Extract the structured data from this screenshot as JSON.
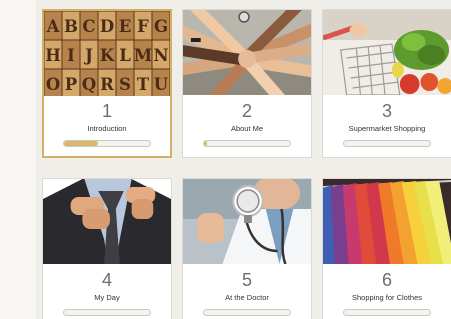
{
  "lessons": [
    {
      "number": "1",
      "title": "Introduction",
      "progress": 0.4,
      "image": "wooden-letter-blocks",
      "active": true
    },
    {
      "number": "2",
      "title": "About Me",
      "progress": 0.04,
      "image": "team-hands-stack",
      "active": false
    },
    {
      "number": "3",
      "title": "Supermarket Shopping",
      "progress": 0,
      "image": "shopping-cart-vegetables",
      "active": false
    },
    {
      "number": "4",
      "title": "My Day",
      "progress": 0,
      "image": "man-adjusting-tie",
      "active": false
    },
    {
      "number": "5",
      "title": "At the Doctor",
      "progress": 0,
      "image": "doctor-stethoscope",
      "active": false
    },
    {
      "number": "6",
      "title": "Shopping for Clothes",
      "progress": 0,
      "image": "clothes-rack",
      "active": false
    }
  ],
  "letter_blocks": [
    "A",
    "B",
    "C",
    "D",
    "E",
    "F",
    "G",
    "H",
    "I",
    "J",
    "K",
    "L",
    "M",
    "N",
    "O",
    "P",
    "Q",
    "R",
    "S",
    "T",
    "U"
  ],
  "colors": {
    "accent": "#d2b066",
    "progress_fill": "#d8b86a",
    "background": "#efeee9"
  }
}
